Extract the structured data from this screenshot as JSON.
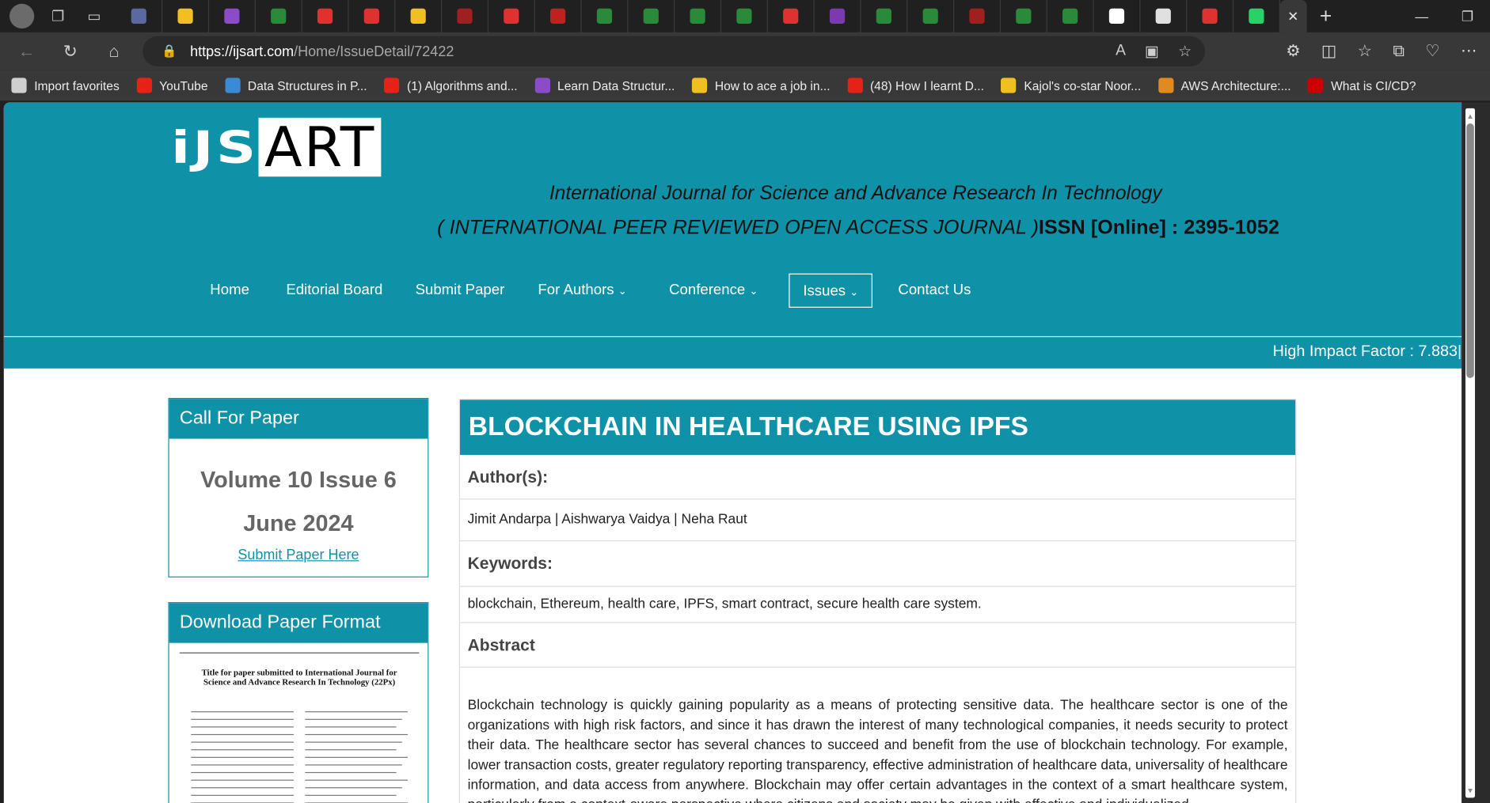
{
  "browser": {
    "url_host": "https://ijsart.com",
    "url_path": "/Home/IssueDetail/72422",
    "tab_close": "✕",
    "new_tab": "+",
    "tab_favicons": [
      "#5a6aa0",
      "#f0c020",
      "#8a4cc7",
      "#2a8a3a",
      "#e03030",
      "#e03030",
      "#f0c020",
      "#a02020",
      "#e03030",
      "#c02020",
      "#2a8a3a",
      "#2a8a3a",
      "#2a8a3a",
      "#2a8a3a",
      "#e03030",
      "#7a3ab0",
      "#2a8a3a",
      "#2a8a3a",
      "#a02020",
      "#2a8a3a",
      "#2a8a3a",
      "#ffffff",
      "#e0e0e0",
      "#e03030",
      "#25d366"
    ]
  },
  "favorites": [
    {
      "label": "Import favorites",
      "color": "#cfcfcf"
    },
    {
      "label": "YouTube",
      "color": "#e62117"
    },
    {
      "label": "Data Structures in P...",
      "color": "#3a8ad6"
    },
    {
      "label": "(1) Algorithms and...",
      "color": "#e62117"
    },
    {
      "label": "Learn Data Structur...",
      "color": "#8a4cc7"
    },
    {
      "label": "How to ace a job in...",
      "color": "#f0c020"
    },
    {
      "label": "(48) How I learnt D...",
      "color": "#e62117"
    },
    {
      "label": "Kajol's co-star Noor...",
      "color": "#f0c020"
    },
    {
      "label": "AWS Architecture:...",
      "color": "#e08a20"
    },
    {
      "label": "What is CI/CD?",
      "color": "#cc0000"
    }
  ],
  "site": {
    "logo_left": "iJS",
    "logo_right": "ART",
    "tagline": "International Journal for Science and Advance Research In Technology",
    "peer_reviewed": "( INTERNATIONAL PEER REVIEWED OPEN ACCESS JOURNAL )",
    "issn": "ISSN [Online] : 2395-1052",
    "impact": "High Impact Factor : 7.883|",
    "nav": [
      "Home",
      "Editorial Board",
      "Submit Paper",
      "For Authors",
      "Conference",
      "Issues",
      "Contact Us"
    ]
  },
  "sidebar": {
    "call_for_paper": "Call For Paper",
    "volume": "Volume 10 Issue 6",
    "month": "June 2024",
    "submit_link": "Submit Paper Here",
    "download_format": "Download Paper Format",
    "pdf_title": "Title for paper submitted to International Journal for Science and Advance Research In Technology (22Px)"
  },
  "article": {
    "title": "BLOCKCHAIN IN HEALTHCARE USING IPFS",
    "authors_label": "Author(s):",
    "authors": "Jimit Andarpa | Aishwarya Vaidya | Neha Raut",
    "keywords_label": "Keywords:",
    "keywords": "blockchain, Ethereum, health care, IPFS, smart contract, secure health care system.",
    "abstract_label": "Abstract",
    "abstract": "Blockchain technology is quickly gaining popularity as a means of protecting sensitive data. The healthcare sector is one of the organizations with high risk factors, and since it has drawn the interest of many technological companies, it needs security to protect their data. The healthcare sector has several chances to succeed and benefit from the use of blockchain technology. For example, lower transaction costs, greater regulatory reporting transparency, effective administration of healthcare data, universality of healthcare information, and data access from anywhere. Blockchain may offer certain advantages in the context of a smart healthcare system, particularly from a context-aware perspective where citizens and society may be given with effective and individualized"
  }
}
